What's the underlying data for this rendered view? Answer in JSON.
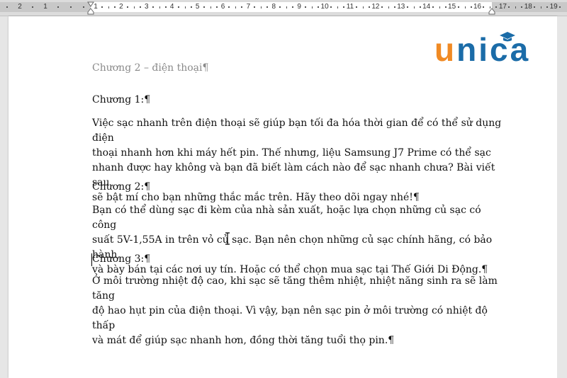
{
  "ruler": {
    "left_numbers": [
      "2",
      "1"
    ],
    "numbers": [
      "1",
      "2",
      "3",
      "4",
      "5",
      "6",
      "7",
      "8",
      "9",
      "10",
      "11",
      "12",
      "13",
      "14",
      "15",
      "16",
      "17",
      "18",
      "19"
    ]
  },
  "logo": {
    "first": "u",
    "rest": "nica",
    "color_primary": "#1b6ca8",
    "color_accent": "#f08a24"
  },
  "document": {
    "header": "Chương 2 – điện thoại¶",
    "sections": [
      {
        "heading": "Chương 1:¶",
        "lines": [
          "Việc sạc nhanh trên điện thoại sẽ giúp bạn tối đa hóa thời gian để có thể sử dụng điện",
          "thoại nhanh hơn khi máy hết pin. Thế nhưng, liệu Samsung J7 Prime có thể sạc",
          "nhanh được hay không và bạn đã biết làm cách nào để sạc nhanh chưa? Bài viết sau",
          "sẽ bật mí cho bạn những thắc mắc trên. Hãy theo dõi ngay nhé!¶"
        ]
      },
      {
        "heading": "Chương 2:¶",
        "lines": [
          "Bạn có thể dùng sạc đi kèm của nhà sản xuất, hoặc lựa chọn những củ sạc có công",
          "suất 5V-1,55A in trên vỏ củ sạc. Bạn nên chọn những củ sạc chính hãng, có bảo hành",
          "và bày bán tại các nơi uy tín. Hoặc có thể chọn mua sạc tại Thế Giới Di Động.¶"
        ]
      },
      {
        "heading": "Chương 3:¶",
        "lines": [
          "Ở môi trường nhiệt độ cao, khi sạc sẽ tăng thêm nhiệt, nhiệt năng sinh ra sẽ làm tăng",
          "độ hao hụt pin của điện thoại. Vì vậy, bạn nên sạc pin ở môi trường có nhiệt độ thấp",
          "và mát để giúp sạc nhanh hơn, đồng thời tăng tuổi thọ pin.¶"
        ]
      }
    ]
  }
}
